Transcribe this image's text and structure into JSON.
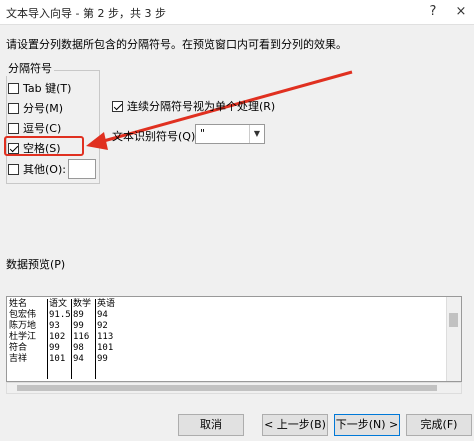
{
  "window": {
    "title": "文本导入向导 - 第 2 步，共 3 步",
    "help": "?",
    "close": "×"
  },
  "instruction": "请设置分列数据所包含的分隔符号。在预览窗口内可看到分列的效果。",
  "delimiters": {
    "title": "分隔符号",
    "options": [
      {
        "label": "Tab 键(T)",
        "checked": false
      },
      {
        "label": "分号(M)",
        "checked": false
      },
      {
        "label": "逗号(C)",
        "checked": false
      },
      {
        "label": "空格(S)",
        "checked": true
      },
      {
        "label": "其他(O):",
        "checked": false
      }
    ]
  },
  "consecutive": {
    "label": "连续分隔符号视为单个处理(R)",
    "checked": true
  },
  "qualifier": {
    "label": "文本识别符号(Q):",
    "value": "\""
  },
  "preview": {
    "label": "数据预览(P)",
    "rows": [
      [
        "姓名",
        "语文",
        "数学",
        "英语"
      ],
      [
        "包宏伟",
        "91.5",
        "89",
        "94"
      ],
      [
        "陈万地",
        "93",
        "99",
        "92"
      ],
      [
        "杜学江",
        "102",
        "116",
        "113"
      ],
      [
        "符合",
        "99",
        "98",
        "101"
      ],
      [
        "吉祥",
        "101",
        "94",
        "99"
      ]
    ]
  },
  "buttons": {
    "cancel": "取消",
    "back": "< 上一步(B)",
    "next": "下一步(N) >",
    "finish": "完成(F)"
  },
  "colors": {
    "highlight": "#e03020",
    "default_button": "#0078d7"
  }
}
